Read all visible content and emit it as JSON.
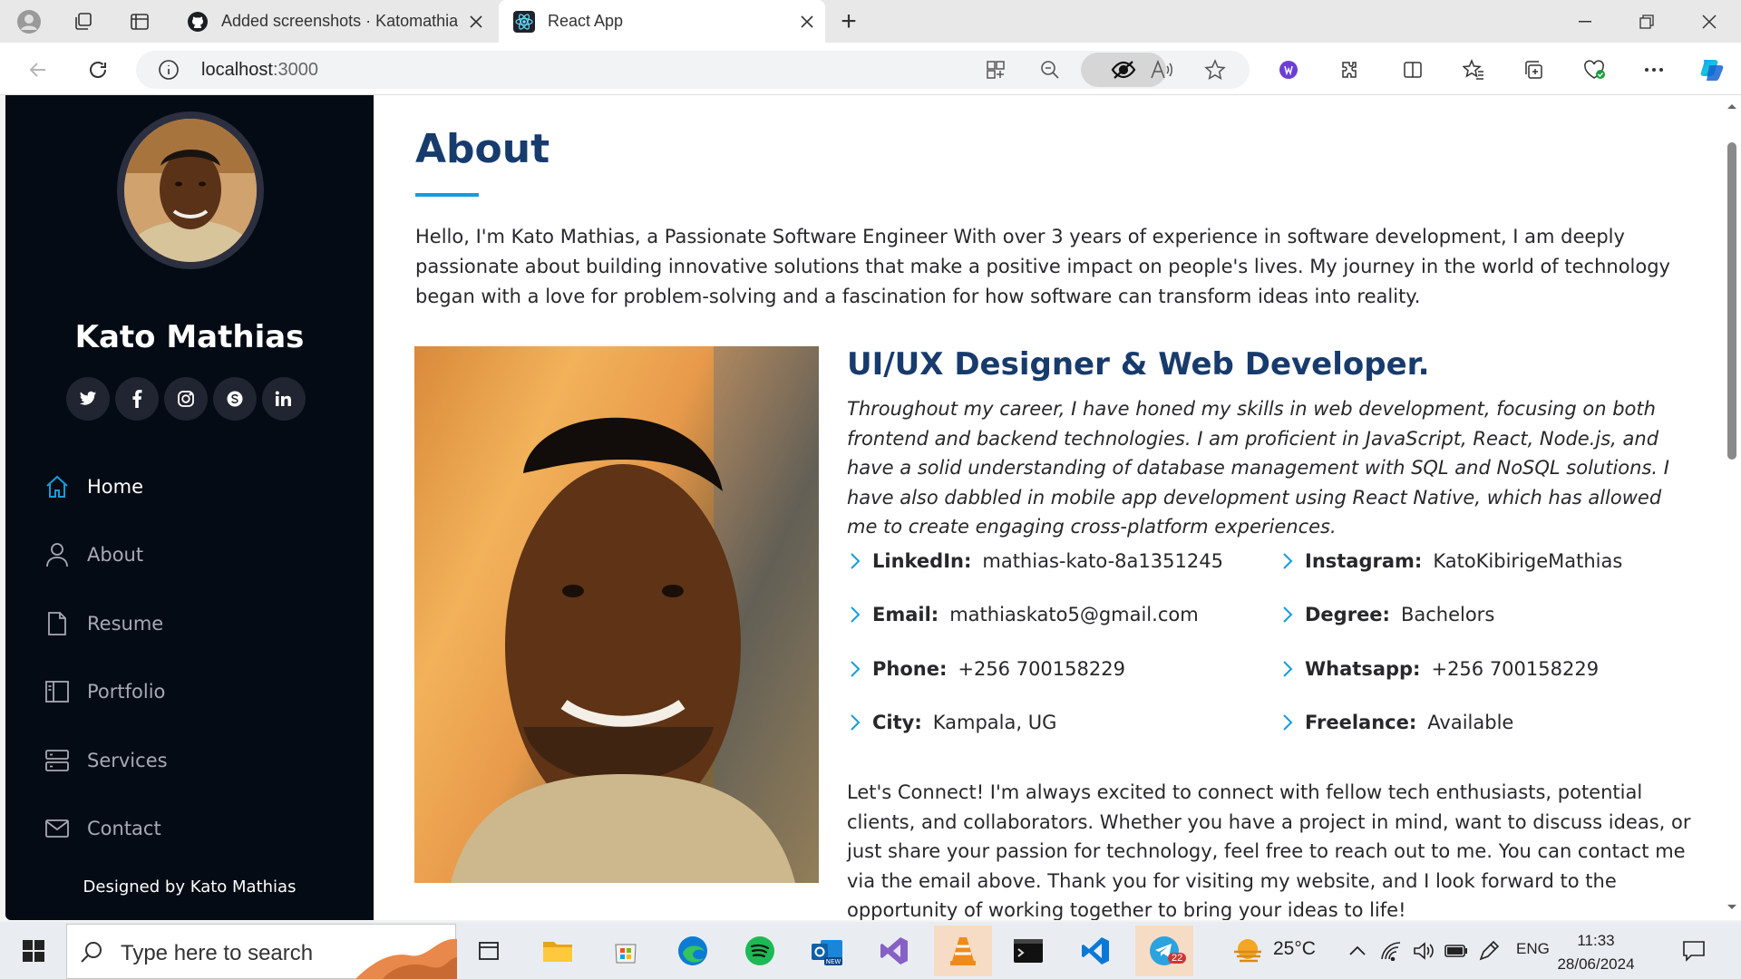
{
  "browser": {
    "tabs": [
      {
        "title": "Added screenshots · Katomathias",
        "favicon": "github-icon"
      },
      {
        "title": "React App",
        "favicon": "react-icon",
        "active": true
      }
    ],
    "new_tab": "+",
    "address": {
      "host": "localhost",
      "port": ":3000"
    }
  },
  "sidebar": {
    "name": "Kato Mathias",
    "socials": [
      "twitter-icon",
      "facebook-icon",
      "instagram-icon",
      "skype-icon",
      "linkedin-icon"
    ],
    "nav": [
      {
        "label": "Home",
        "icon": "home-icon",
        "active": true
      },
      {
        "label": "About",
        "icon": "person-icon"
      },
      {
        "label": "Resume",
        "icon": "file-icon"
      },
      {
        "label": "Portfolio",
        "icon": "book-icon"
      },
      {
        "label": "Services",
        "icon": "server-icon"
      },
      {
        "label": "Contact",
        "icon": "envelope-icon"
      }
    ],
    "credits": "Designed by Kato Mathias"
  },
  "about": {
    "title": "About",
    "intro": "Hello, I'm Kato Mathias, a Passionate Software Engineer With over 3 years of experience in software development, I am deeply passionate about building innovative solutions that make a positive impact on people's lives. My journey in the world of technology began with a love for problem-solving and a fascination for how software can transform ideas into reality.",
    "role": "UI/UX Designer & Web Developer.",
    "description": "Throughout my career, I have honed my skills in web development, focusing on both frontend and backend technologies. I am proficient in JavaScript, React, Node.js, and have a solid understanding of database management with SQL and NoSQL solutions. I have also dabbled in mobile app development using React Native, which has allowed me to create engaging cross-platform experiences.",
    "info": [
      {
        "label": "LinkedIn:",
        "value": "mathias-kato-8a1351245"
      },
      {
        "label": "Instagram:",
        "value": "KatoKibirigeMathias"
      },
      {
        "label": "Email:",
        "value": "mathiaskato5@gmail.com"
      },
      {
        "label": "Degree:",
        "value": "Bachelors"
      },
      {
        "label": "Phone:",
        "value": "+256 700158229"
      },
      {
        "label": "Whatsapp:",
        "value": "+256 700158229"
      },
      {
        "label": "City:",
        "value": "Kampala, UG"
      },
      {
        "label": "Freelance:",
        "value": "Available"
      }
    ],
    "connect": "Let's Connect! I'm always excited to connect with fellow tech enthusiasts, potential clients, and collaborators. Whether you have a project in mind, want to discuss ideas, or just share your passion for technology, feel free to reach out to me. You can contact me via the email above. Thank you for visiting my website, and I look forward to the opportunity of working together to bring your ideas to life!"
  },
  "taskbar": {
    "search_placeholder": "Type here to search",
    "weather": "25°C",
    "language": "ENG",
    "time": "11:33",
    "date": "28/06/2024",
    "telegram_badge": "22"
  },
  "colors": {
    "accent": "#149ddd",
    "heading": "#173b6c",
    "sidebar_bg": "#040b14"
  }
}
